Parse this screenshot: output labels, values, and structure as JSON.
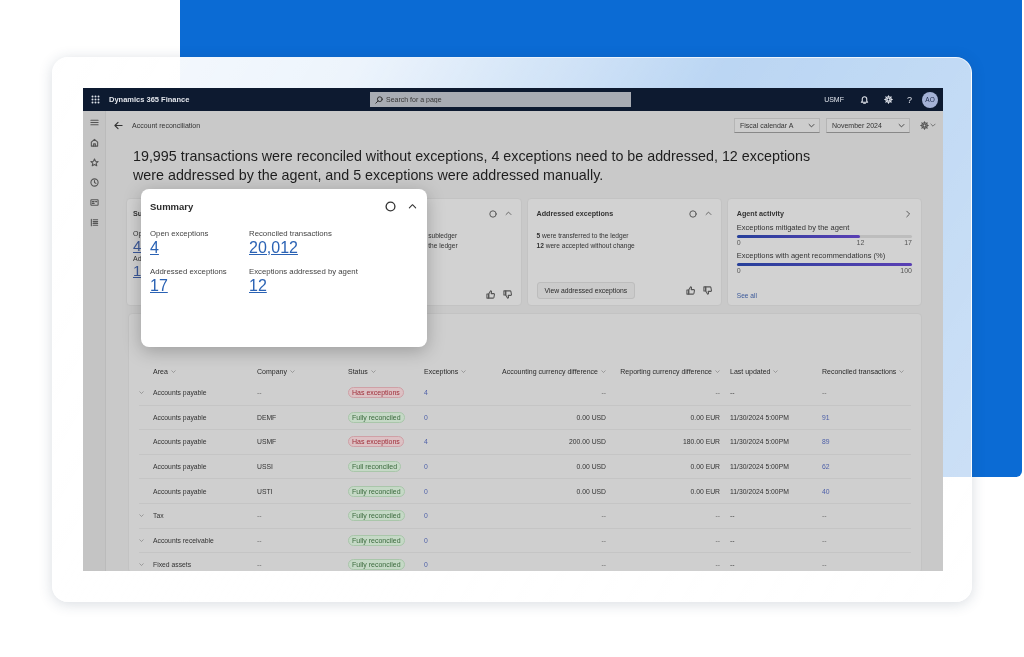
{
  "top_bar": {
    "app_name": "Dynamics 365 Finance",
    "search": {
      "placeholder": "Search for a page"
    },
    "company": "USMF",
    "help": "?",
    "avatar": "AO"
  },
  "page": {
    "title": "Account reconciliation",
    "filters": [
      {
        "value": "Fiscal calendar A"
      },
      {
        "value": "November 2024"
      }
    ]
  },
  "headline": "19,995 transactions were reconciled without exceptions, 4 exceptions need to be addressed, 12 exceptions were addressed by the agent, and 5 exceptions were addressed manually.",
  "cards": [
    {
      "kind": "metrics",
      "title": "Su",
      "metrics": [
        {
          "label": "Op",
          "value": "4"
        },
        {
          "label": "Ad",
          "value": "1"
        }
      ]
    },
    {
      "kind": "notes",
      "lines": [
        "subledger",
        "the ledger"
      ]
    },
    {
      "kind": "notes",
      "title": "Addressed exceptions",
      "lines": [
        "**5** were transferred to the ledger",
        "**12** were accepted without change"
      ],
      "button": "View addressed exceptions"
    },
    {
      "kind": "bars",
      "title": "Agent activity",
      "bars": [
        {
          "label": "Exceptions mitigated by the agent",
          "level": 0.706,
          "ticks": [
            "0",
            "12",
            "17"
          ]
        },
        {
          "label": "Exceptions with agent recommendations (%)",
          "level": 1,
          "ticks": [
            "0",
            "100"
          ]
        }
      ],
      "link": "See all"
    }
  ],
  "grid": {
    "columns": [
      "Area",
      "Company",
      "Status",
      "Exceptions",
      "Accounting currency difference",
      "Reporting currency difference",
      "Last updated",
      "Reconciled transactions"
    ],
    "rows": [
      {
        "kind": "group",
        "area": "Accounts payable",
        "company": "--",
        "status": {
          "label": "Has exceptions",
          "kind": "exceptions"
        },
        "exceptions": "4",
        "accounting_difference": "--",
        "reporting_difference": "--",
        "last_updated": "--",
        "reconciled": "--"
      },
      {
        "kind": "item",
        "area": "Accounts payable",
        "company": "DEMF",
        "status": {
          "label": "Fully reconciled",
          "kind": "reconciled"
        },
        "exceptions": "0",
        "accounting_difference": "0.00 USD",
        "reporting_difference": "0.00 EUR",
        "last_updated": "11/30/2024 5:00PM",
        "reconciled": "91"
      },
      {
        "kind": "item",
        "area": "Accounts payable",
        "company": "USMF",
        "status": {
          "label": "Has exceptions",
          "kind": "exceptions"
        },
        "exceptions": "4",
        "accounting_difference": "200.00 USD",
        "reporting_difference": "180.00 EUR",
        "last_updated": "11/30/2024 5:00PM",
        "reconciled": "89"
      },
      {
        "kind": "item",
        "area": "Accounts payable",
        "company": "USSI",
        "status": {
          "label": "Full reconciled",
          "kind": "reconciled"
        },
        "exceptions": "0",
        "accounting_difference": "0.00 USD",
        "reporting_difference": "0.00 EUR",
        "last_updated": "11/30/2024 5:00PM",
        "reconciled": "62"
      },
      {
        "kind": "item",
        "area": "Accounts payable",
        "company": "USTI",
        "status": {
          "label": "Fully reconciled",
          "kind": "reconciled"
        },
        "exceptions": "0",
        "accounting_difference": "0.00 USD",
        "reporting_difference": "0.00 EUR",
        "last_updated": "11/30/2024 5:00PM",
        "reconciled": "40"
      },
      {
        "kind": "group",
        "area": "Tax",
        "company": "--",
        "status": {
          "label": "Fully reconciled",
          "kind": "reconciled"
        },
        "exceptions": "0",
        "accounting_difference": "--",
        "reporting_difference": "--",
        "last_updated": "--",
        "reconciled": "--"
      },
      {
        "kind": "group",
        "area": "Accounts receivable",
        "company": "--",
        "status": {
          "label": "Fully reconciled",
          "kind": "reconciled"
        },
        "exceptions": "0",
        "accounting_difference": "--",
        "reporting_difference": "--",
        "last_updated": "--",
        "reconciled": "--"
      },
      {
        "kind": "group",
        "area": "Fixed assets",
        "company": "--",
        "status": {
          "label": "Fully reconciled",
          "kind": "reconciled"
        },
        "exceptions": "0",
        "accounting_difference": "--",
        "reporting_difference": "--",
        "last_updated": "--",
        "reconciled": "--"
      }
    ]
  },
  "summary_popup": {
    "title": "Summary",
    "metrics": [
      {
        "label": "Open exceptions",
        "value": "4"
      },
      {
        "label": "Reconciled transactions",
        "value": "20,012"
      },
      {
        "label": "Addressed exceptions",
        "value": "17"
      },
      {
        "label": "Exceptions addressed by agent",
        "value": "12"
      }
    ]
  }
}
